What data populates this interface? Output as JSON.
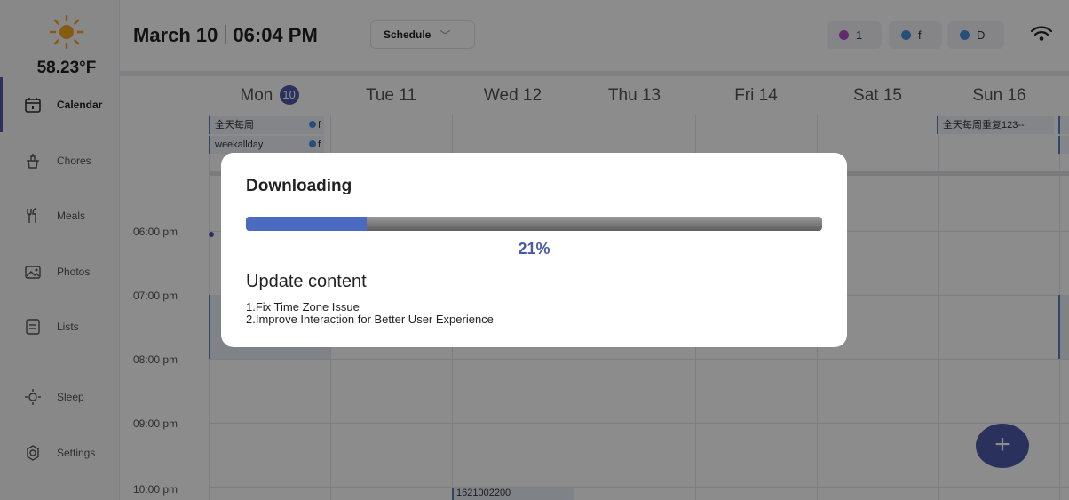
{
  "weather": {
    "icon": "sun-icon",
    "temperature": "58.23°F"
  },
  "nav": [
    {
      "label": "Calendar",
      "icon": "calendar-icon",
      "active": true
    },
    {
      "label": "Chores",
      "icon": "chores-icon"
    },
    {
      "label": "Meals",
      "icon": "meals-icon"
    },
    {
      "label": "Photos",
      "icon": "photos-icon"
    },
    {
      "label": "Lists",
      "icon": "lists-icon"
    },
    {
      "label": "Sleep",
      "icon": "sleep-icon"
    },
    {
      "label": "Settings",
      "icon": "settings-icon"
    }
  ],
  "header": {
    "date": "March 10",
    "time": "06:04 PM",
    "view_selector": "Schedule",
    "members": [
      {
        "label": "1",
        "color": "#b24ec9"
      },
      {
        "label": "f",
        "color": "#4a90d9"
      },
      {
        "label": "D",
        "color": "#4a90d9"
      }
    ]
  },
  "days": [
    {
      "name": "Mon",
      "date": "10",
      "today": true
    },
    {
      "name": "Tue 11"
    },
    {
      "name": "Wed 12"
    },
    {
      "name": "Thu 13"
    },
    {
      "name": "Fri 14"
    },
    {
      "name": "Sat 15"
    },
    {
      "name": "Sun 16"
    }
  ],
  "all_day_events": [
    {
      "title": "全天每周",
      "member": "f"
    },
    {
      "title": "weekallday",
      "member": "f"
    },
    {
      "title": "全天每周重复123--"
    }
  ],
  "time_labels": [
    "06:00 pm",
    "07:00 pm",
    "08:00 pm",
    "09:00 pm",
    "10:00 pm"
  ],
  "timed_events": [
    {
      "text": "1621002200"
    }
  ],
  "dialog": {
    "title": "Downloading",
    "progress": 0.21,
    "percent_label": "21%",
    "update_title": "Update content",
    "update_items": [
      "1.Fix Time Zone Issue",
      "2.Improve Interaction for Better User Experience"
    ]
  },
  "colors": {
    "accent": "#4b5aa8",
    "progress_fill": "#4b6bc0"
  }
}
